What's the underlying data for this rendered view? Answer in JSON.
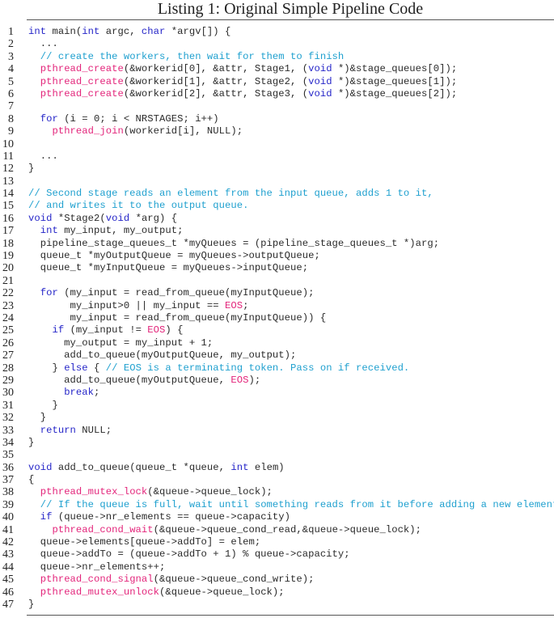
{
  "caption": "Listing 1: Original Simple Pipeline Code",
  "colors": {
    "keyword": "#2525c8",
    "function": "#e3257b",
    "comment": "#1fa0cf",
    "constant": "#e3257b",
    "plain": "#2a2a2a"
  },
  "lines": [
    {
      "n": "1",
      "tokens": [
        [
          "kw",
          "int"
        ],
        [
          "pl",
          " main("
        ],
        [
          "kw",
          "int"
        ],
        [
          "pl",
          " argc, "
        ],
        [
          "kw",
          "char"
        ],
        [
          "pl",
          " *argv[]) {"
        ]
      ]
    },
    {
      "n": "2",
      "tokens": [
        [
          "pl",
          "  ..."
        ]
      ]
    },
    {
      "n": "3",
      "tokens": [
        [
          "pl",
          "  "
        ],
        [
          "cm",
          "// create the workers, then wait for them to finish"
        ]
      ]
    },
    {
      "n": "4",
      "tokens": [
        [
          "pl",
          "  "
        ],
        [
          "fn",
          "pthread_create"
        ],
        [
          "pl",
          "(&workerid[0], &attr, Stage1, ("
        ],
        [
          "kw",
          "void"
        ],
        [
          "pl",
          " *)&stage_queues[0]);"
        ]
      ]
    },
    {
      "n": "5",
      "tokens": [
        [
          "pl",
          "  "
        ],
        [
          "fn",
          "pthread_create"
        ],
        [
          "pl",
          "(&workerid[1], &attr, Stage2, ("
        ],
        [
          "kw",
          "void"
        ],
        [
          "pl",
          " *)&stage_queues[1]);"
        ]
      ]
    },
    {
      "n": "6",
      "tokens": [
        [
          "pl",
          "  "
        ],
        [
          "fn",
          "pthread_create"
        ],
        [
          "pl",
          "(&workerid[2], &attr, Stage3, ("
        ],
        [
          "kw",
          "void"
        ],
        [
          "pl",
          " *)&stage_queues[2]);"
        ]
      ]
    },
    {
      "n": "7",
      "tokens": []
    },
    {
      "n": "8",
      "tokens": [
        [
          "pl",
          "  "
        ],
        [
          "kw",
          "for"
        ],
        [
          "pl",
          " (i = 0; i < NRSTAGES; i++)"
        ]
      ]
    },
    {
      "n": "9",
      "tokens": [
        [
          "pl",
          "    "
        ],
        [
          "fn",
          "pthread_join"
        ],
        [
          "pl",
          "(workerid[i], NULL);"
        ]
      ]
    },
    {
      "n": "10",
      "tokens": []
    },
    {
      "n": "11",
      "tokens": [
        [
          "pl",
          "  ..."
        ]
      ]
    },
    {
      "n": "12",
      "tokens": [
        [
          "pl",
          "}"
        ]
      ]
    },
    {
      "n": "13",
      "tokens": []
    },
    {
      "n": "14",
      "tokens": [
        [
          "cm",
          "// Second stage reads an element from the input queue, adds 1 to it,"
        ]
      ]
    },
    {
      "n": "15",
      "tokens": [
        [
          "cm",
          "// and writes it to the output queue."
        ]
      ]
    },
    {
      "n": "16",
      "tokens": [
        [
          "kw",
          "void"
        ],
        [
          "pl",
          " *Stage2("
        ],
        [
          "kw",
          "void"
        ],
        [
          "pl",
          " *arg) {"
        ]
      ]
    },
    {
      "n": "17",
      "tokens": [
        [
          "pl",
          "  "
        ],
        [
          "kw",
          "int"
        ],
        [
          "pl",
          " my_input, my_output;"
        ]
      ]
    },
    {
      "n": "18",
      "tokens": [
        [
          "pl",
          "  pipeline_stage_queues_t *myQueues = (pipeline_stage_queues_t *)arg;"
        ]
      ]
    },
    {
      "n": "19",
      "tokens": [
        [
          "pl",
          "  queue_t *myOutputQueue = myQueues->outputQueue;"
        ]
      ]
    },
    {
      "n": "20",
      "tokens": [
        [
          "pl",
          "  queue_t *myInputQueue = myQueues->inputQueue;"
        ]
      ]
    },
    {
      "n": "21",
      "tokens": []
    },
    {
      "n": "22",
      "tokens": [
        [
          "pl",
          "  "
        ],
        [
          "kw",
          "for"
        ],
        [
          "pl",
          " (my_input = read_from_queue(myInputQueue);"
        ]
      ]
    },
    {
      "n": "23",
      "tokens": [
        [
          "pl",
          "       my_input>0 || my_input == "
        ],
        [
          "const",
          "EOS"
        ],
        [
          "pl",
          ";"
        ]
      ]
    },
    {
      "n": "24",
      "tokens": [
        [
          "pl",
          "       my_input = read_from_queue(myInputQueue)) {"
        ]
      ]
    },
    {
      "n": "25",
      "tokens": [
        [
          "pl",
          "    "
        ],
        [
          "kw",
          "if"
        ],
        [
          "pl",
          " (my_input != "
        ],
        [
          "const",
          "EOS"
        ],
        [
          "pl",
          ") {"
        ]
      ]
    },
    {
      "n": "26",
      "tokens": [
        [
          "pl",
          "      my_output = my_input + 1;"
        ]
      ]
    },
    {
      "n": "27",
      "tokens": [
        [
          "pl",
          "      add_to_queue(myOutputQueue, my_output);"
        ]
      ]
    },
    {
      "n": "28",
      "tokens": [
        [
          "pl",
          "    } "
        ],
        [
          "kw",
          "else"
        ],
        [
          "pl",
          " { "
        ],
        [
          "cm",
          "// EOS is a terminating token. Pass on if received."
        ]
      ]
    },
    {
      "n": "29",
      "tokens": [
        [
          "pl",
          "      add_to_queue(myOutputQueue, "
        ],
        [
          "const",
          "EOS"
        ],
        [
          "pl",
          ");"
        ]
      ]
    },
    {
      "n": "30",
      "tokens": [
        [
          "pl",
          "      "
        ],
        [
          "kw",
          "break"
        ],
        [
          "pl",
          ";"
        ]
      ]
    },
    {
      "n": "31",
      "tokens": [
        [
          "pl",
          "    }"
        ]
      ]
    },
    {
      "n": "32",
      "tokens": [
        [
          "pl",
          "  }"
        ]
      ]
    },
    {
      "n": "33",
      "tokens": [
        [
          "pl",
          "  "
        ],
        [
          "kw",
          "return"
        ],
        [
          "pl",
          " NULL;"
        ]
      ]
    },
    {
      "n": "34",
      "tokens": [
        [
          "pl",
          "}"
        ]
      ]
    },
    {
      "n": "35",
      "tokens": []
    },
    {
      "n": "36",
      "tokens": [
        [
          "kw",
          "void"
        ],
        [
          "pl",
          " add_to_queue(queue_t *queue, "
        ],
        [
          "kw",
          "int"
        ],
        [
          "pl",
          " elem)"
        ]
      ]
    },
    {
      "n": "37",
      "tokens": [
        [
          "pl",
          "{"
        ]
      ]
    },
    {
      "n": "38",
      "tokens": [
        [
          "pl",
          "  "
        ],
        [
          "fn",
          "pthread_mutex_lock"
        ],
        [
          "pl",
          "(&queue->queue_lock);"
        ]
      ]
    },
    {
      "n": "39",
      "tokens": [
        [
          "pl",
          "  "
        ],
        [
          "cm",
          "// If the queue is full, wait until something reads from it before adding a new element"
        ]
      ]
    },
    {
      "n": "40",
      "tokens": [
        [
          "pl",
          "  "
        ],
        [
          "kw",
          "if"
        ],
        [
          "pl",
          " (queue->nr_elements == queue->capacity)"
        ]
      ]
    },
    {
      "n": "41",
      "tokens": [
        [
          "pl",
          "    "
        ],
        [
          "fn",
          "pthread_cond_wait"
        ],
        [
          "pl",
          "(&queue->queue_cond_read,&queue->queue_lock);"
        ]
      ]
    },
    {
      "n": "42",
      "tokens": [
        [
          "pl",
          "  queue->elements[queue->addTo] = elem;"
        ]
      ]
    },
    {
      "n": "43",
      "tokens": [
        [
          "pl",
          "  queue->addTo = (queue->addTo + 1) % queue->capacity;"
        ]
      ]
    },
    {
      "n": "44",
      "tokens": [
        [
          "pl",
          "  queue->nr_elements++;"
        ]
      ]
    },
    {
      "n": "45",
      "tokens": [
        [
          "pl",
          "  "
        ],
        [
          "fn",
          "pthread_cond_signal"
        ],
        [
          "pl",
          "(&queue->queue_cond_write);"
        ]
      ]
    },
    {
      "n": "46",
      "tokens": [
        [
          "pl",
          "  "
        ],
        [
          "fn",
          "pthread_mutex_unlock"
        ],
        [
          "pl",
          "(&queue->queue_lock);"
        ]
      ]
    },
    {
      "n": "47",
      "tokens": [
        [
          "pl",
          "}"
        ]
      ]
    }
  ]
}
